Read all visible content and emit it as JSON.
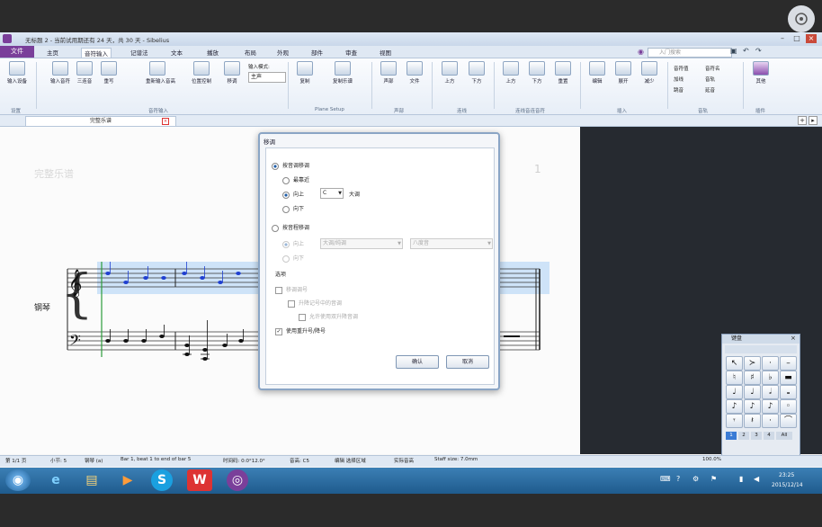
{
  "app": {
    "title": "无标题 2 - 当前试用期还有 24 天，共 30 天 - Sibelius",
    "search_placeholder": "入门搜索",
    "file_tab": "文件",
    "tabs": [
      "主页",
      "音符输入",
      "记谱法",
      "文本",
      "播放",
      "布局",
      "外观",
      "部件",
      "审查",
      "视图"
    ]
  },
  "ribbon": {
    "buttons": [
      "输入设备",
      "输入音符",
      "三连音",
      "重写",
      "重新输入音高",
      "位置控制",
      "移调",
      "复制",
      "复制乐谱",
      "声部",
      "文件",
      "上方",
      "下方",
      "上方",
      "下方",
      "重置",
      "编辑",
      "展开",
      "减少"
    ],
    "input_mode_label": "输入模式:",
    "input_mode_value": "主声",
    "right_items": [
      "音符值",
      "音符名",
      "加线",
      "音轨",
      "跳音",
      "延音",
      "音符",
      "其他"
    ],
    "groups": [
      "设置",
      "音符输入",
      "Plane Setup",
      "声部",
      "连线",
      "连线音连音符",
      "插入",
      "音轨",
      "插件"
    ]
  },
  "document": {
    "tab_label": "完整乐谱",
    "score_title": "完整乐谱",
    "page_number": "1",
    "instrument": "钢琴"
  },
  "dialog": {
    "title": "移调",
    "section1": "按音调移调",
    "opt_by_half": "最靠近",
    "opt_up": "向上",
    "key_value": "C",
    "key_suffix": "大调",
    "opt_down": "向下",
    "section2": "按音程移调",
    "up2": "向上",
    "down2": "向下",
    "interval_value": "大调/纯调",
    "octave_value": "八度音",
    "options_label": "选项",
    "chk1": "移调调号",
    "chk2": "升降记号中的音调",
    "chk3": "允许使用双升降音调",
    "chk4": "使用重升号/降号",
    "ok": "确认",
    "cancel": "取消"
  },
  "statusbar": [
    "第 1/1 页",
    "小节: 5",
    "钢琴 (a)",
    "Bar 1, beat 1 to end of bar 5",
    "时间码: 0:0°12.0°",
    "音高: C5",
    "编辑 选择区域",
    "实际音高",
    "Staff size: 7.0mm"
  ],
  "statusbar_right": "100.0%",
  "keypad": {
    "title": "键盘",
    "keys": [
      "↖",
      "≻",
      "·",
      "–",
      "♮",
      "♯",
      "♭",
      "▬",
      "♩",
      "♩",
      "𝅗𝅥",
      "𝅝",
      "♪",
      "♪",
      "♪",
      "◦",
      "𝄾",
      "𝄽",
      "·",
      "⌒"
    ],
    "tabs": [
      "1",
      "2",
      "3",
      "4",
      "All"
    ]
  },
  "taskbar": {
    "apps": [
      "◉",
      "e",
      "▤",
      "▶",
      "S",
      "W",
      "◎"
    ],
    "time": "23:25",
    "date": "2015/12/14"
  },
  "colors": {
    "file_tab": "#7a3f9a",
    "selection": "#9cc7f0",
    "taskbar": "#2b6ca3",
    "notes_selected": "#1f3fd0"
  }
}
